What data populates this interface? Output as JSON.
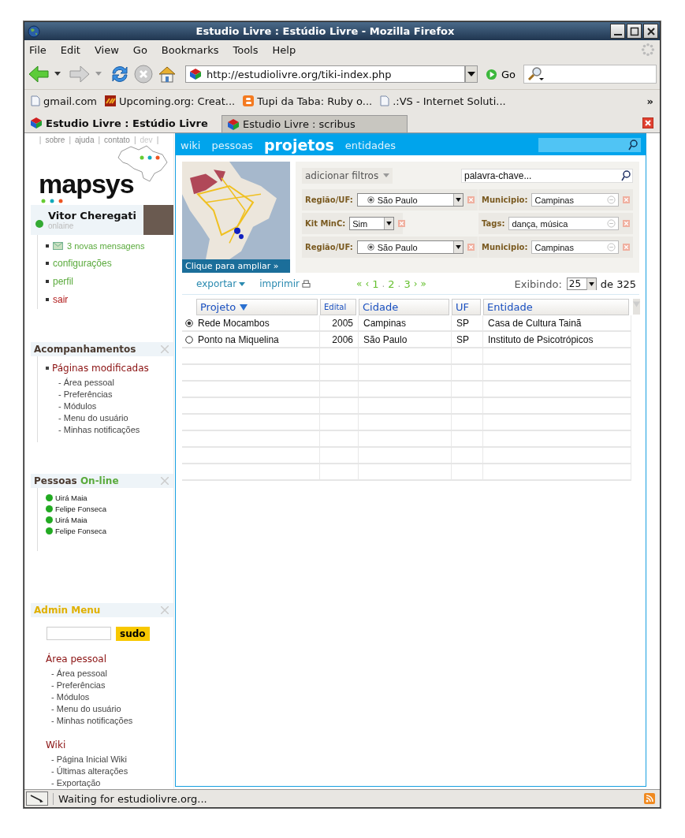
{
  "window": {
    "title": "Estudio Livre : Estúdio Livre - Mozilla Firefox"
  },
  "menu": [
    "File",
    "Edit",
    "View",
    "Go",
    "Bookmarks",
    "Tools",
    "Help"
  ],
  "toolbar": {
    "url": "http://estudiolivre.org/tiki-index.php",
    "go_label": "Go"
  },
  "bookmarks": [
    {
      "label": "gmail.com",
      "kind": "page"
    },
    {
      "label": "Upcoming.org: Creat...",
      "kind": "upcoming"
    },
    {
      "label": "Tupi da Taba: Ruby o...",
      "kind": "blogger"
    },
    {
      "label": ".:VS - Internet Soluti...",
      "kind": "page"
    }
  ],
  "bookmarks_more": "»",
  "tabs": [
    {
      "label": "Estudio Livre : Estúdio Livre",
      "selected": true
    },
    {
      "label": "Estudio Livre : scribus",
      "selected": false
    }
  ],
  "sidebar": {
    "top_links": [
      {
        "label": "|",
        "kind": "separator"
      },
      {
        "label": "sobre",
        "kind": "link",
        "disabled": false
      },
      {
        "label": "|",
        "kind": "separator"
      },
      {
        "label": "ajuda",
        "kind": "link",
        "disabled": false
      },
      {
        "label": "|",
        "kind": "separator"
      },
      {
        "label": "contato",
        "kind": "link",
        "disabled": false
      },
      {
        "label": "|",
        "kind": "separator"
      },
      {
        "label": "dev",
        "kind": "link",
        "disabled": true
      },
      {
        "label": "|",
        "kind": "separator"
      }
    ],
    "logo": "mapsys",
    "user": {
      "name": "Vitor Cheregati",
      "status": "onlaine"
    },
    "user_menu": [
      {
        "label": "3 novas mensagens",
        "kind": "messages",
        "color": "#5aaa3c"
      },
      {
        "label": "configurações",
        "kind": "link",
        "color": "#5aaa3c"
      },
      {
        "label": "perfil",
        "kind": "link",
        "color": "#5aaa3c"
      },
      {
        "label": "sair",
        "kind": "link",
        "color": "#b01818"
      }
    ],
    "tracking": {
      "title": "Acompanhamentos",
      "section": "Páginas modificadas",
      "items": [
        "- Área pessoal",
        "- Preferências",
        "- Módulos",
        "- Menu do usuário",
        "- Minhas notificações"
      ]
    },
    "online": {
      "title": "Pessoas",
      "title_highlight": "On-line",
      "people": [
        "Uirá Maia",
        "Felipe Fonseca",
        "Uirá Maia",
        "Felipe Fonseca"
      ]
    },
    "admin": {
      "title": "Admin Menu",
      "sudo_button": "sudo",
      "sections": [
        {
          "title": "Área pessoal",
          "items": [
            "- Área pessoal",
            "- Preferências",
            "- Módulos",
            "- Menu do usuário",
            "- Minhas notificações"
          ]
        },
        {
          "title": "Wiki",
          "items": [
            "- Página Inicial Wiki",
            "- Últimas alterações",
            "- Exportação"
          ]
        }
      ]
    }
  },
  "main": {
    "nav": [
      {
        "label": "wiki",
        "selected": false
      },
      {
        "label": "pessoas",
        "selected": false
      },
      {
        "label": "projetos",
        "selected": true
      },
      {
        "label": "entidades",
        "selected": false
      }
    ],
    "map_caption": "Clique para ampliar »",
    "add_filters": "adicionar filtros",
    "keyword": "palavra-chave...",
    "filter_rows": [
      [
        {
          "label": "Região/UF:",
          "kind": "radio-select",
          "value": "São Paulo"
        },
        {
          "label": "Municipio:",
          "kind": "text",
          "value": "Campinas"
        }
      ],
      [
        {
          "label": "Kit MinC:",
          "kind": "select",
          "value": "Sim"
        },
        {
          "label": "Tags:",
          "kind": "text",
          "value": "dança, música"
        }
      ],
      [
        {
          "label": "Região/UF:",
          "kind": "radio-select",
          "value": "São Paulo"
        },
        {
          "label": "Municipio:",
          "kind": "text",
          "value": "Campinas"
        }
      ]
    ],
    "export": "exportar",
    "print": "imprimir",
    "pagination": [
      {
        "label": "«",
        "kind": "arrow"
      },
      {
        "label": "‹",
        "kind": "arrow"
      },
      {
        "label": "1",
        "kind": "page"
      },
      {
        "label": ".",
        "kind": "sep"
      },
      {
        "label": "2",
        "kind": "page"
      },
      {
        "label": ".",
        "kind": "sep"
      },
      {
        "label": "3",
        "kind": "page"
      },
      {
        "label": "›",
        "kind": "arrow"
      },
      {
        "label": "»",
        "kind": "arrow"
      }
    ],
    "showing_label": "Exibindo:",
    "per_page": "25",
    "total": "de 325",
    "table": {
      "columns": [
        {
          "label": "Projeto",
          "sorted": true
        },
        {
          "label": "Edital",
          "sorted": false
        },
        {
          "label": "Cidade",
          "sorted": false
        },
        {
          "label": "UF",
          "sorted": false
        },
        {
          "label": "Entidade",
          "sorted": false
        }
      ],
      "rows": [
        {
          "selected": true,
          "cells": [
            "Rede Mocambos",
            "2005",
            "Campinas",
            "SP",
            "Casa de Cultura Tainã"
          ]
        },
        {
          "selected": false,
          "cells": [
            "Ponto na Miquelina",
            "2006",
            "São Paulo",
            "SP",
            "Instituto de Psicotrópicos"
          ]
        }
      ]
    }
  },
  "status_bar": "Waiting for estudiolivre.org..."
}
